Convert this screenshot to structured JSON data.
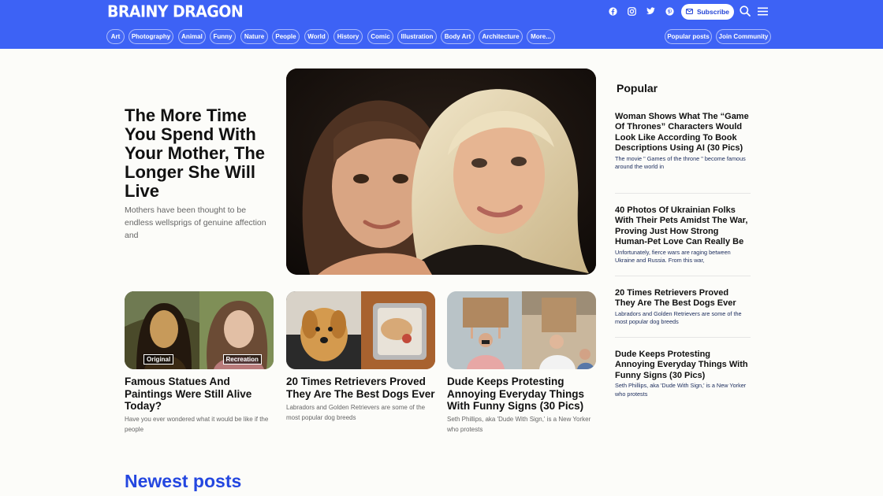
{
  "header": {
    "logo": "BRAINY DRAGON",
    "subscribe_label": "Subscribe",
    "social": [
      "facebook-icon",
      "instagram-icon",
      "twitter-icon",
      "pinterest-icon"
    ],
    "nav": [
      "Art",
      "Photography",
      "Animal",
      "Funny",
      "Nature",
      "People",
      "World",
      "History",
      "Comic",
      "Illustration",
      "Body Art",
      "Architecture",
      "More..."
    ],
    "right_nav": [
      "Popular posts",
      "Join Community"
    ],
    "colors": {
      "bar": "#3d62f5",
      "accent": "#2447e0"
    }
  },
  "hero": {
    "title": "The More Time You Spend With Your Mother, The Longer She Will Live",
    "excerpt": "Mothers have been thought to be endless wellsprigs of genuine affection and"
  },
  "cards": [
    {
      "title": "Famous Statues And Paintings Were Still Alive Today?",
      "excerpt": "Have you ever wondered what it would be like if the people",
      "tags": [
        "Original",
        "Recreation"
      ]
    },
    {
      "title": "20 Times Retrievers Proved They Are The Best Dogs Ever",
      "excerpt": "Labradors and Golden Retrievers are some of the most popular dog breeds"
    },
    {
      "title": "Dude Keeps Protesting Annoying Everyday Things With Funny Signs (30 Pics)",
      "excerpt": "Seth Phillips, aka 'Dude With Sign,' is a New Yorker who protests"
    }
  ],
  "popular": {
    "heading": "Popular",
    "items": [
      {
        "title": "Woman Shows What The “Game Of Thrones” Characters Would Look Like According To Book Descriptions Using AI (30 Pics)",
        "excerpt": "The movie \" Games of the throne \" become famous around the world in"
      },
      {
        "title": "40 Photos Of Ukrainian Folks With Their Pets Amidst The War, Proving Just How Strong Human-Pet Love Can Really Be",
        "excerpt": "Unfortunately, fierce wars are raging between Ukraine and Russia. From this war,"
      },
      {
        "title": "20 Times Retrievers Proved They Are The Best Dogs Ever",
        "excerpt": "Labradors and Golden Retrievers are some of the most popular dog breeds"
      },
      {
        "title": "Dude Keeps Protesting Annoying Everyday Things With Funny Signs (30 Pics)",
        "excerpt": "Seth Phillips, aka 'Dude With Sign,' is a New Yorker who protests"
      }
    ]
  },
  "newest_heading": "Newest posts"
}
